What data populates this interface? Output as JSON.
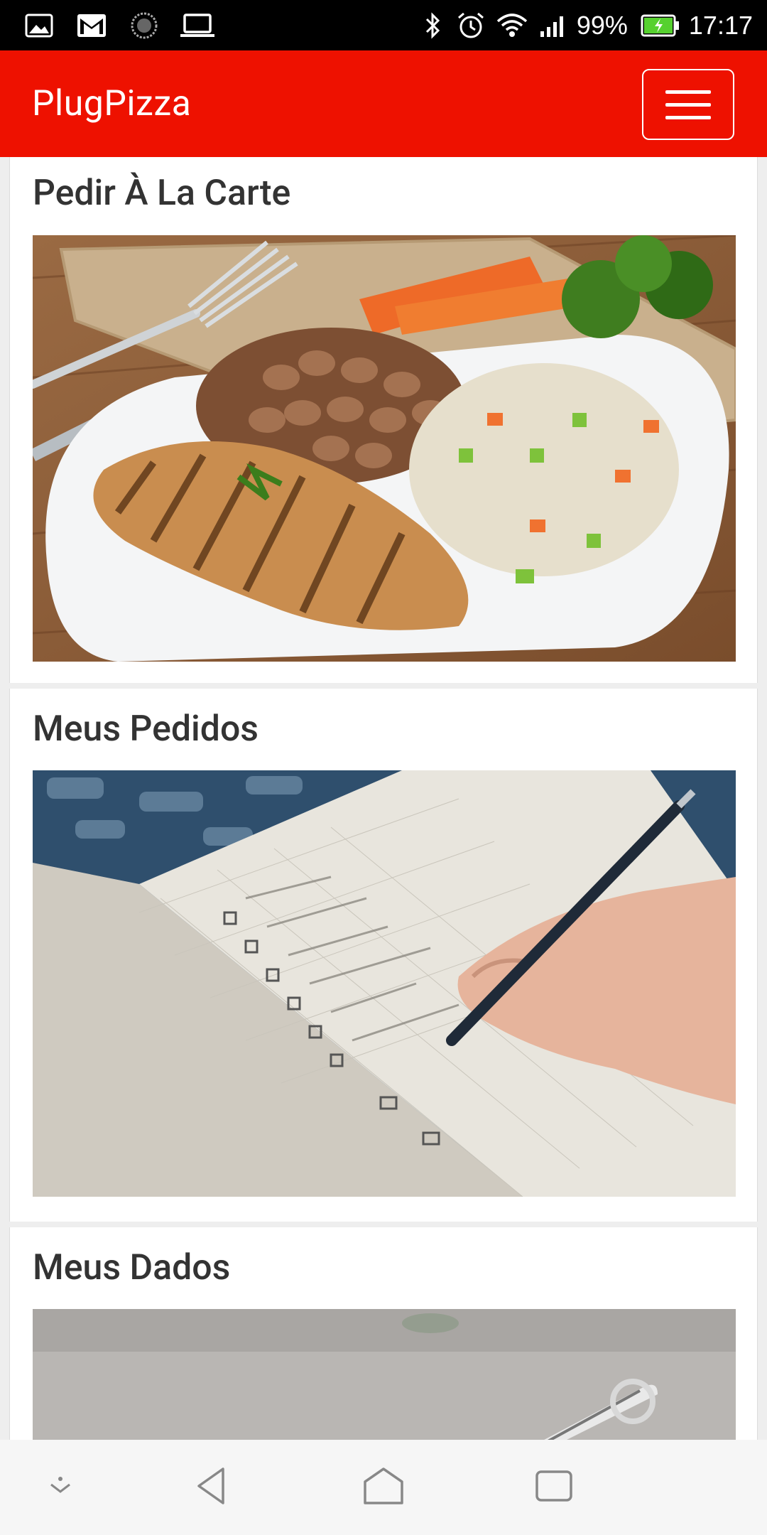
{
  "status_bar": {
    "left_icons": [
      "image-icon",
      "gmail-icon",
      "sync-icon",
      "laptop-icon"
    ],
    "right_icons": [
      "bluetooth-icon",
      "alarm-icon",
      "wifi-icon",
      "signal-icon"
    ],
    "battery_percent": "99%",
    "time": "17:17"
  },
  "header": {
    "brand": "PlugPizza"
  },
  "cards": [
    {
      "title": "Pedir À La Carte",
      "image": "meal-plate-image"
    },
    {
      "title": "Meus Pedidos",
      "image": "notebook-checklist-image"
    },
    {
      "title": "Meus Dados",
      "image": "personal-data-image"
    }
  ],
  "nav_bar": {
    "buttons": [
      "collapse-icon",
      "back-icon",
      "home-icon",
      "recents-icon"
    ]
  },
  "colors": {
    "brand_red": "#ee1100",
    "status_bar": "#000000",
    "title_text": "#333333"
  }
}
